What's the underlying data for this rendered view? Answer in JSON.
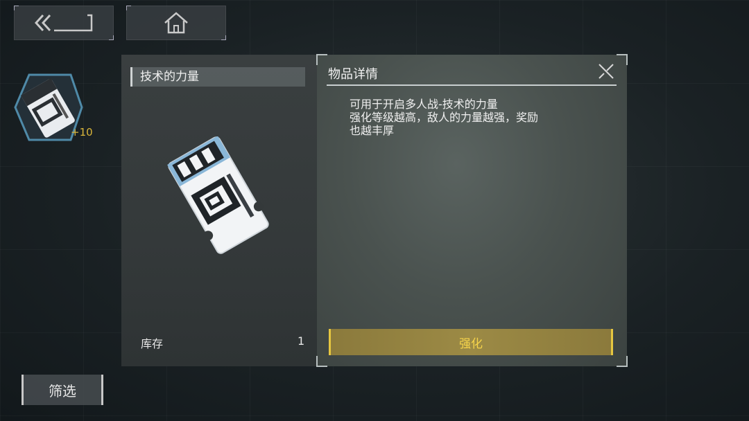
{
  "nav": {
    "back_icon": "double-chevron-back-icon",
    "home_icon": "home-icon"
  },
  "inventory": {
    "item_count": "+10",
    "filter_label": "筛选"
  },
  "item_panel": {
    "name": "技术的力量",
    "stock_label": "库存",
    "stock_value": "1"
  },
  "detail_panel": {
    "title": "物品详情",
    "description_lines": [
      "可用于开启多人战-技术的力量",
      "强化等级越高，敌人的力量越强，奖励",
      "也越丰厚"
    ],
    "enhance_label": "强化"
  },
  "colors": {
    "accent_gold": "#e6c640",
    "count_gold": "#d9b53a"
  }
}
